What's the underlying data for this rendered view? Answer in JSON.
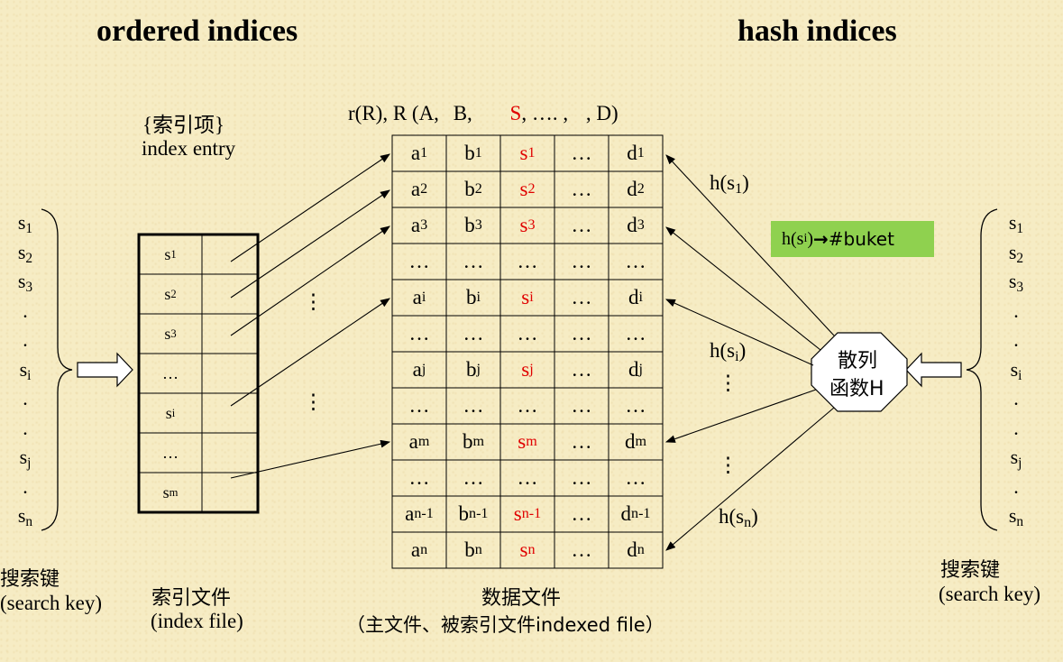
{
  "titles": {
    "ordered": "ordered indices",
    "hash": "hash indices"
  },
  "index_entry": {
    "cn": "{索引项}",
    "en": "index entry"
  },
  "relation": {
    "prefix": "r(R), R (A,",
    "b": "B,",
    "s": "S",
    "rest": ", …. ,",
    "end": ", D)"
  },
  "keys_left": [
    [
      "s",
      "1"
    ],
    [
      "s",
      "2"
    ],
    [
      "s",
      "3"
    ],
    [
      ".",
      ""
    ],
    [
      ".",
      ""
    ],
    [
      "s",
      "i"
    ],
    [
      ".",
      ""
    ],
    [
      ".",
      ""
    ],
    [
      "s",
      "j"
    ],
    [
      ".",
      ""
    ],
    [
      "s",
      "n"
    ]
  ],
  "keys_right": [
    [
      "s",
      "1"
    ],
    [
      "s",
      "2"
    ],
    [
      "s",
      "3"
    ],
    [
      ".",
      ""
    ],
    [
      ".",
      ""
    ],
    [
      "s",
      "i"
    ],
    [
      ".",
      ""
    ],
    [
      ".",
      ""
    ],
    [
      "s",
      "j"
    ],
    [
      ".",
      ""
    ],
    [
      "s",
      "n"
    ]
  ],
  "index_rows": [
    [
      "s",
      "1"
    ],
    [
      "s",
      "2"
    ],
    [
      "s",
      "3"
    ],
    [
      "…",
      ""
    ],
    [
      "s",
      "i"
    ],
    [
      "…",
      ""
    ],
    [
      "s",
      "m"
    ]
  ],
  "data_rows": [
    [
      [
        "a",
        "1"
      ],
      [
        "b",
        "1"
      ],
      [
        "s",
        "1"
      ],
      [
        "…",
        ""
      ],
      [
        "d",
        "1"
      ]
    ],
    [
      [
        "a",
        "2"
      ],
      [
        "b",
        "2"
      ],
      [
        "s",
        "2"
      ],
      [
        "…",
        ""
      ],
      [
        "d",
        "2"
      ]
    ],
    [
      [
        "a",
        "3"
      ],
      [
        "b",
        "3"
      ],
      [
        "s",
        "3"
      ],
      [
        "…",
        ""
      ],
      [
        "d",
        "3"
      ]
    ],
    [
      [
        "…",
        ""
      ],
      [
        "…",
        ""
      ],
      [
        "…",
        ""
      ],
      [
        "…",
        ""
      ],
      [
        "…",
        ""
      ]
    ],
    [
      [
        "a",
        "i"
      ],
      [
        "b",
        "i"
      ],
      [
        "s",
        "i"
      ],
      [
        "…",
        ""
      ],
      [
        "d",
        "i"
      ]
    ],
    [
      [
        "…",
        ""
      ],
      [
        "…",
        ""
      ],
      [
        "…",
        ""
      ],
      [
        "…",
        ""
      ],
      [
        "…",
        ""
      ]
    ],
    [
      [
        "a",
        "j"
      ],
      [
        "b",
        "j"
      ],
      [
        "s",
        "j"
      ],
      [
        "…",
        ""
      ],
      [
        "d",
        "j"
      ]
    ],
    [
      [
        "…",
        ""
      ],
      [
        "…",
        ""
      ],
      [
        "…",
        ""
      ],
      [
        "…",
        ""
      ],
      [
        "…",
        ""
      ]
    ],
    [
      [
        "a",
        "m"
      ],
      [
        "b",
        "m"
      ],
      [
        "s",
        "m"
      ],
      [
        "…",
        ""
      ],
      [
        "d",
        "m"
      ]
    ],
    [
      [
        "…",
        ""
      ],
      [
        "…",
        ""
      ],
      [
        "…",
        ""
      ],
      [
        "…",
        ""
      ],
      [
        "…",
        ""
      ]
    ],
    [
      [
        "a",
        "n-1"
      ],
      [
        "b",
        "n-1"
      ],
      [
        "s",
        "n-1"
      ],
      [
        "…",
        ""
      ],
      [
        "d",
        "n-1"
      ]
    ],
    [
      [
        "a",
        "n"
      ],
      [
        "b",
        "n"
      ],
      [
        "s",
        "n"
      ],
      [
        "…",
        ""
      ],
      [
        "d",
        "n"
      ]
    ]
  ],
  "hash_labels": {
    "h": "h(s",
    "s1": "1",
    "si": "i",
    "sn": "n",
    "close": ")"
  },
  "badge": {
    "h": "h(s",
    "sub": "i",
    "rest": ")",
    "arrow": "→",
    "bucket": "#buket"
  },
  "hash_func": {
    "line1": "散列",
    "line2": "函数H"
  },
  "vdots": "⋮",
  "bottom": {
    "search_key_cn": "搜索键",
    "search_key_en": "(search key)",
    "index_file_cn": "索引文件",
    "index_file_en": "(index file)",
    "data_file_cn": "数据文件",
    "data_file_en": "（主文件、被索引文件indexed file）"
  },
  "colors": {
    "highlight": "#e00000",
    "badge": "#8fd14f",
    "background": "#f6ecc4"
  }
}
